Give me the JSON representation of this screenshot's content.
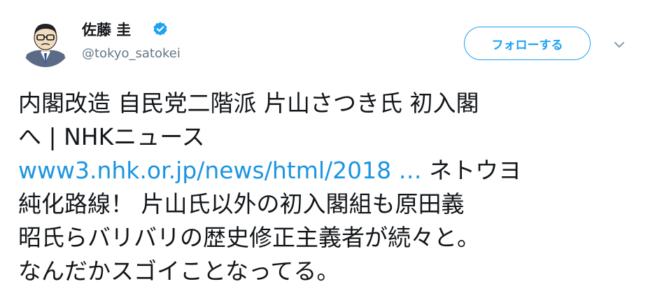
{
  "user": {
    "display_name": "佐藤 圭",
    "handle": "@tokyo_satokei",
    "verified": true,
    "avatar_icon": "caricature-avatar-icon",
    "verified_icon": "verified-badge-icon"
  },
  "header": {
    "follow_label": "フォローする",
    "menu_icon": "chevron-down-icon"
  },
  "tweet": {
    "line1": "内閣改造 自民党二階派 片山さつき氏 初入閣",
    "line2": "へ | NHKニュース",
    "link_text": "www3.nhk.or.jp/news/html/2018 …",
    "line3_rest": "  ネトウヨ",
    "line4": "純化路線！ 片山氏以外の初入閣組も原田義",
    "line5": "昭氏らバリバリの歴史修正主義者が続々と。",
    "line6": "なんだかスゴイことなってる。"
  },
  "colors": {
    "accent": "#1da1f2",
    "link": "#1b95e0",
    "text": "#14171a",
    "muted": "#657786"
  }
}
